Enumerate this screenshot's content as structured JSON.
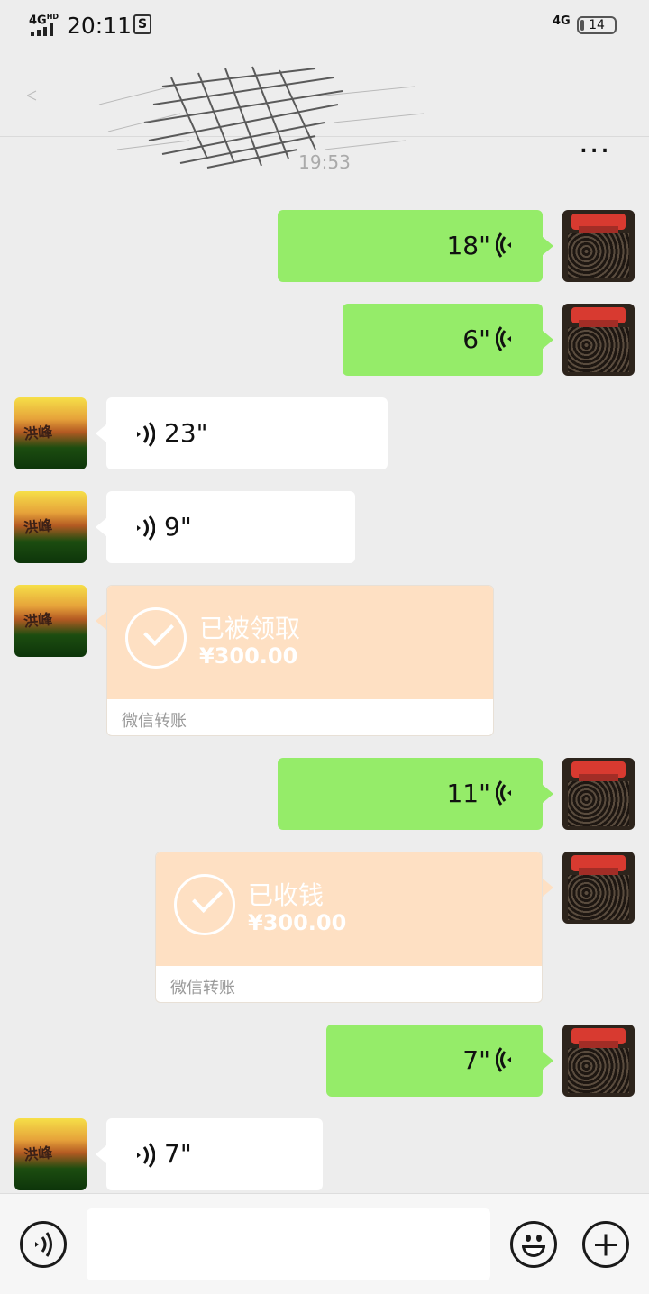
{
  "status_bar": {
    "network": "4G",
    "network_sup": "HD",
    "time": "20:11",
    "notif_icon": "S",
    "network_right": "4G",
    "battery": "14"
  },
  "nav": {
    "more_label": "..."
  },
  "timestamp": "19:53",
  "messages": [
    {
      "side": "right",
      "type": "voice",
      "duration": "18\""
    },
    {
      "side": "right",
      "type": "voice",
      "duration": "6\""
    },
    {
      "side": "left",
      "type": "voice",
      "duration": "23\""
    },
    {
      "side": "left",
      "type": "voice",
      "duration": "9\""
    },
    {
      "side": "left",
      "type": "transfer",
      "status": "已被领取",
      "amount": "¥300.00",
      "footer": "微信转账"
    },
    {
      "side": "right",
      "type": "voice",
      "duration": "11\""
    },
    {
      "side": "right",
      "type": "transfer",
      "status": "已收钱",
      "amount": "¥300.00",
      "footer": "微信转账"
    },
    {
      "side": "right",
      "type": "voice",
      "duration": "7\""
    },
    {
      "side": "left",
      "type": "voice",
      "duration": "7\""
    }
  ],
  "colors": {
    "sent_bubble": "#95ec69",
    "received_bubble": "#ffffff",
    "transfer_card": "#fee0c3",
    "background": "#ededed"
  }
}
